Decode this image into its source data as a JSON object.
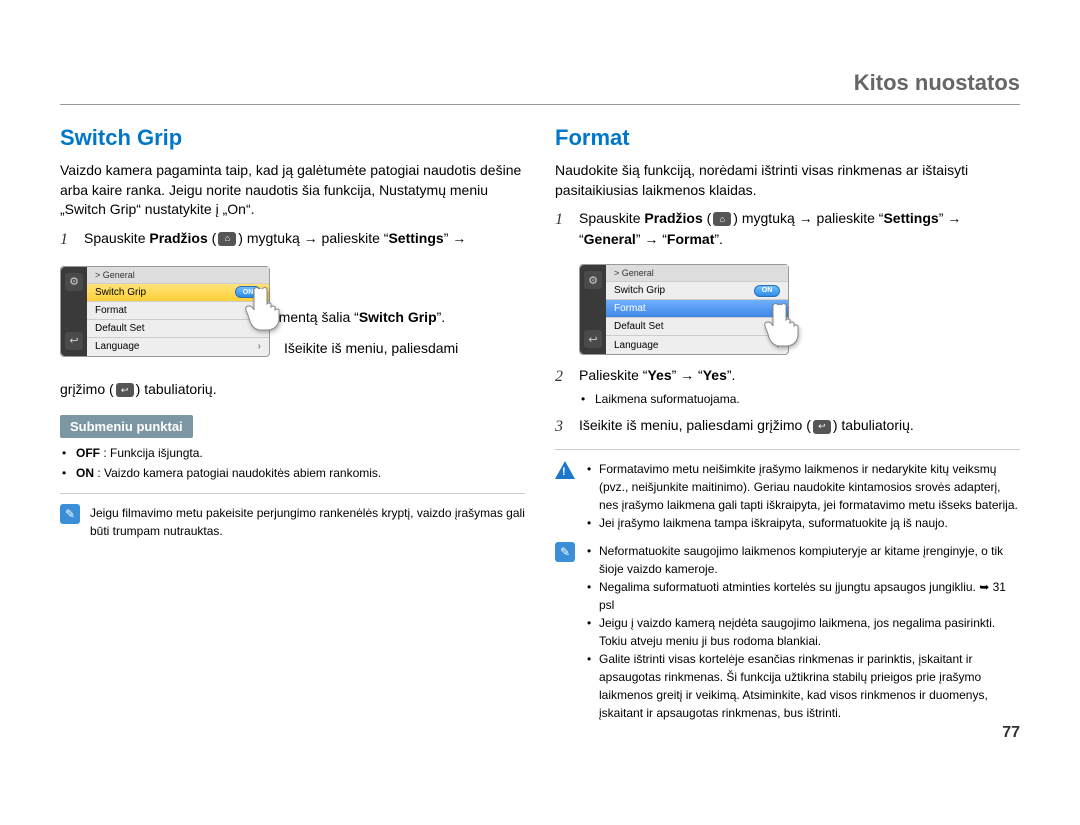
{
  "header": {
    "title": "Kitos nuostatos"
  },
  "page_number": "77",
  "left": {
    "heading": "Switch Grip",
    "intro": "Vaizdo kamera pagaminta taip, kad ją galėtumėte patogiai naudotis dešine arba kaire ranka. Jeigu norite naudotis šia funkcija, Nustatymų meniu „Switch Grip“ nustatykite į „On“.",
    "step1_prefix": "Spauskite ",
    "step1_bold1": "Pradžios",
    "step1_mid": " mygtuką → palieskite “",
    "step1_bold2": "Settings",
    "step1_end": "” →",
    "step2_suffix": "elementą šalia “",
    "step2_bold": "Switch Grip",
    "step2_end": "”.",
    "step3": "Išeikite iš meniu, paliesdami",
    "step3b": "grįžimo ( ) tabuliatorių.",
    "sub_title": "Submeniu punktai",
    "sub_off_label": "OFF",
    "sub_off_text": " : Funkcija išjungta.",
    "sub_on_label": "ON",
    "sub_on_text": " : Vaizdo kamera patogiai naudokitės abiem rankomis.",
    "note": "Jeigu filmavimo metu pakeisite perjungimo rankenėlės kryptį, vaizdo įrašymas gali būti trumpam nutrauktas."
  },
  "right": {
    "heading": "Format",
    "intro": "Naudokite šią funkciją, norėdami ištrinti visas rinkmenas ar ištaisyti pasitaikiusias laikmenos klaidas.",
    "step1_prefix": "Spauskite ",
    "step1_bold1": "Pradžios",
    "step1_mid": " mygtuką → palieskite “",
    "step1_bold2": "Settings",
    "step1_mid2": "” → “",
    "step1_bold3": "General",
    "step1_mid3": "” → “",
    "step1_bold4": "Format",
    "step1_end": "”.",
    "step2a_prefix": "Palieskite “",
    "step2a_bold1": "Yes",
    "step2a_mid": "” → “",
    "step2a_bold2": "Yes",
    "step2a_end": "”.",
    "step2b": "Laikmena suformatuojama.",
    "step3_prefix": "Išeikite iš meniu, paliesdami grįžimo (",
    "step3_suffix": ") tabuliatorių.",
    "warn1": "Formatavimo metu neišimkite įrašymo laikmenos ir nedarykite kitų veiksmų (pvz., neišjunkite maitinimo). Geriau naudokite kintamosios srovės adapterį, nes įrašymo laikmena gali tapti iškraipyta, jei formatavimo metu išseks baterija.",
    "warn2": "Jei įrašymo laikmena tampa iškraipyta, suformatuokite ją iš naujo.",
    "info1": "Neformatuokite saugojimo laikmenos kompiuteryje ar kitame įrenginyje, o tik šioje vaizdo kameroje.",
    "info2": "Negalima suformatuoti atminties kortelės su įjungtu apsaugos jungikliu. ➥ 31 psl",
    "info3": "Jeigu į vaizdo kamerą neįdėta saugojimo laikmena, jos negalima pasirinkti. Tokiu atveju meniu ji bus rodoma blankiai.",
    "info4": "Galite ištrinti visas kortelėje esančias rinkmenas ir parinktis, įskaitant ir apsaugotas rinkmenas. Ši funkcija užtikrina stabilų prieigos prie įrašymo laikmenos greitį ir veikimą. Atsiminkite, kad visos rinkmenos ir duomenys, įskaitant ir apsaugotas rinkmenas, bus ištrinti."
  },
  "ui": {
    "crumb": "> General",
    "items": [
      "Switch Grip",
      "Format",
      "Default Set",
      "Language"
    ],
    "toggle": "ON"
  }
}
